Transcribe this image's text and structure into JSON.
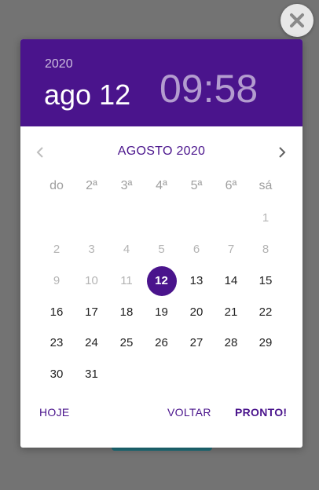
{
  "header": {
    "year": "2020",
    "date": "ago 12",
    "time": "09:58"
  },
  "calendar": {
    "month_label": "AGOSTO 2020",
    "weekdays": [
      "do",
      "2ª",
      "3ª",
      "4ª",
      "5ª",
      "6ª",
      "sá"
    ],
    "selected_day": "12",
    "weeks": [
      [
        "",
        "",
        "",
        "",
        "",
        "",
        "1"
      ],
      [
        "2",
        "3",
        "4",
        "5",
        "6",
        "7",
        "8"
      ],
      [
        "9",
        "10",
        "11",
        "12",
        "13",
        "14",
        "15"
      ],
      [
        "16",
        "17",
        "18",
        "19",
        "20",
        "21",
        "22"
      ],
      [
        "23",
        "24",
        "25",
        "26",
        "27",
        "28",
        "29"
      ],
      [
        "30",
        "31",
        "",
        "",
        "",
        "",
        ""
      ]
    ]
  },
  "footer": {
    "today_label": "HOJE",
    "back_label": "VOLTAR",
    "done_label": "PRONTO!"
  },
  "colors": {
    "primary": "#4a148c",
    "overlay": "#737373",
    "disabled": "#b4b4b4"
  },
  "icons": {
    "close": "close-icon",
    "prev": "chevron-left-icon",
    "next": "chevron-right-icon"
  }
}
